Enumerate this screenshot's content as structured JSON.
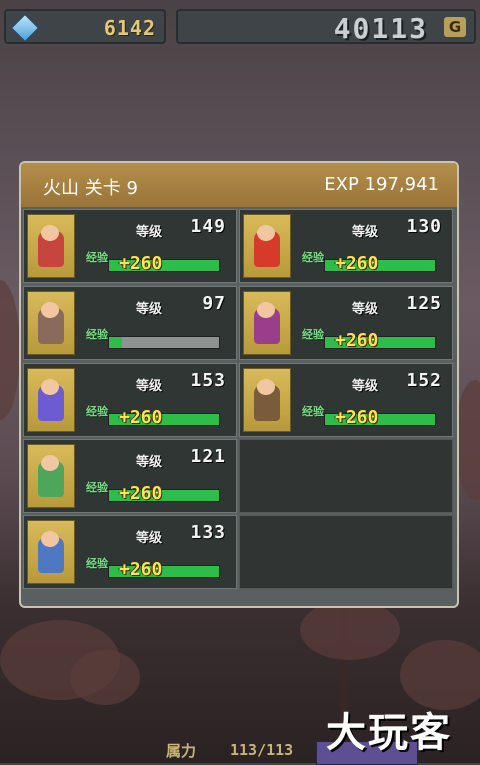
{
  "top": {
    "gems": "6142",
    "gold": "40113",
    "gold_unit": "G"
  },
  "panel": {
    "title": "火山 关卡 9",
    "exp": "EXP 197,941",
    "level_label": "等级",
    "exp_tag": "经验",
    "slots": [
      {
        "level": "149",
        "bonus": "+260",
        "bar_fill": 1.0,
        "color": "#c8443e"
      },
      {
        "level": "130",
        "bonus": "+260",
        "bar_fill": 1.0,
        "color": "#d53a2b"
      },
      {
        "level": "97",
        "bonus": "",
        "bar_fill": 0.0,
        "color": "#8a6b5b"
      },
      {
        "level": "125",
        "bonus": "+260",
        "bar_fill": 1.0,
        "color": "#9a3e8c"
      },
      {
        "level": "153",
        "bonus": "+260",
        "bar_fill": 1.0,
        "color": "#6c5bd1"
      },
      {
        "level": "152",
        "bonus": "+260",
        "bar_fill": 1.0,
        "color": "#7a5b3b"
      },
      {
        "level": "121",
        "bonus": "+260",
        "bar_fill": 1.0,
        "color": "#4ea65b"
      },
      {
        "level": "133",
        "bonus": "+260",
        "bar_fill": 1.0,
        "color": "#4f78c2"
      }
    ]
  },
  "bottom": {
    "power_label": "属力",
    "power_value": "113/113",
    "power_fill": 1.0
  },
  "watermark": "大玩客"
}
